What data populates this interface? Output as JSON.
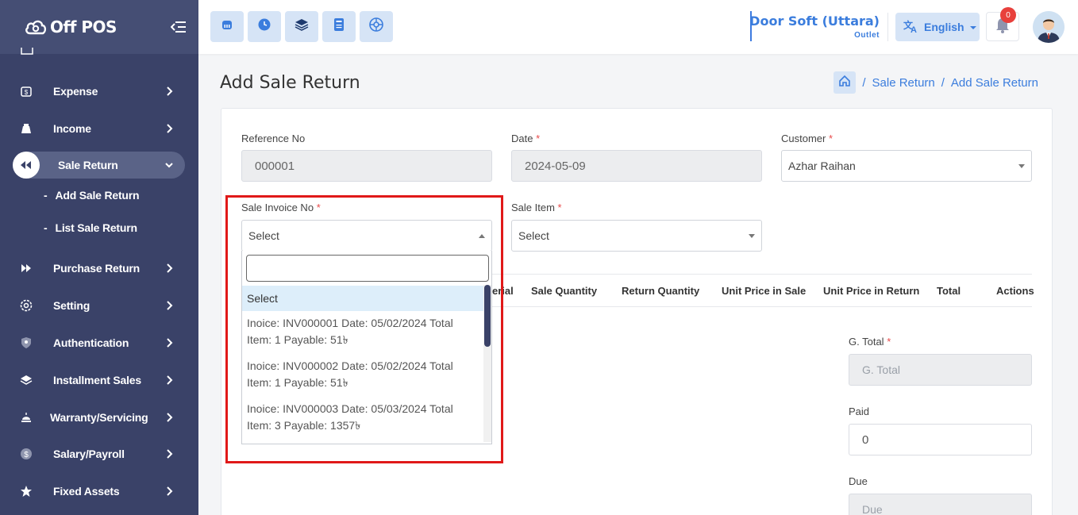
{
  "app": {
    "logo_text": "Off POS"
  },
  "sidebar": {
    "items": [
      {
        "label": "Expense",
        "icon": "expense-icon"
      },
      {
        "label": "Income",
        "icon": "income-icon"
      },
      {
        "label": "Sale Return",
        "icon": "sale-return-icon"
      },
      {
        "label": "Purchase Return",
        "icon": "purchase-return-icon"
      },
      {
        "label": "Setting",
        "icon": "gear-icon"
      },
      {
        "label": "Authentication",
        "icon": "shield-icon"
      },
      {
        "label": "Installment Sales",
        "icon": "layers-icon"
      },
      {
        "label": "Warranty/Servicing",
        "icon": "servicing-icon"
      },
      {
        "label": "Salary/Payroll",
        "icon": "dollar-icon"
      },
      {
        "label": "Fixed Assets",
        "icon": "star-icon"
      }
    ],
    "sub_items": [
      {
        "label": "Add Sale Return"
      },
      {
        "label": "List Sale Return"
      }
    ],
    "sub_prefix": "-"
  },
  "topbar": {
    "store_name": "Door Soft (Uttara)",
    "store_sub": "Outlet",
    "language": "English",
    "notification_count": "0"
  },
  "page": {
    "title": "Add Sale Return",
    "breadcrumb": [
      "Sale Return",
      "Add Sale Return"
    ],
    "breadcrumb_sep": "/"
  },
  "form": {
    "reference_label": "Reference No",
    "reference_value": "000001",
    "date_label": "Date",
    "date_value": "2024-05-09",
    "customer_label": "Customer",
    "customer_value": "Azhar Raihan",
    "invoice_label": "Sale Invoice No",
    "invoice_value": "Select",
    "item_label": "Sale Item",
    "item_value": "Select",
    "required_mark": "*",
    "gtotal_label": "G. Total",
    "gtotal_placeholder": "G. Total",
    "paid_label": "Paid",
    "paid_value": "0",
    "due_label": "Due",
    "due_placeholder": "Due"
  },
  "table": {
    "headers": [
      "erial",
      "Sale Quantity",
      "Return Quantity",
      "Unit Price in Sale",
      "Unit Price in Return",
      "Total",
      "Actions"
    ]
  },
  "dropdown": {
    "search_value": "",
    "options": [
      {
        "line1": "Select",
        "line2": ""
      },
      {
        "line1": "Inoice: INV000001 Date: 05/02/2024 Total",
        "line2": "Item: 1 Payable: 51৳"
      },
      {
        "line1": "Inoice: INV000002 Date: 05/02/2024 Total",
        "line2": "Item: 1 Payable: 51৳"
      },
      {
        "line1": "Inoice: INV000003 Date: 05/03/2024 Total",
        "line2": "Item: 3 Payable: 1357৳"
      }
    ]
  }
}
